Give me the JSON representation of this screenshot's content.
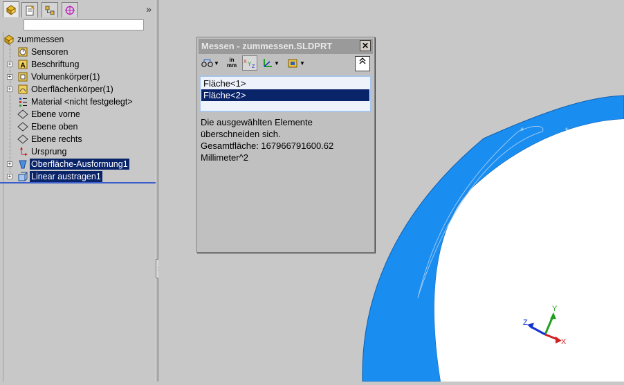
{
  "tree": {
    "root": "zummessen",
    "items": [
      {
        "label": "Sensoren",
        "icon": "sensor-icon",
        "expandable": false
      },
      {
        "label": "Beschriftung",
        "icon": "annotation-icon",
        "expandable": true
      },
      {
        "label": "Volumenkörper(1)",
        "icon": "solid-bodies-icon",
        "expandable": true
      },
      {
        "label": "Oberflächenkörper(1)",
        "icon": "surface-bodies-icon",
        "expandable": true
      },
      {
        "label": "Material <nicht festgelegt>",
        "icon": "material-icon",
        "expandable": false
      },
      {
        "label": "Ebene vorne",
        "icon": "plane-icon",
        "expandable": false
      },
      {
        "label": "Ebene oben",
        "icon": "plane-icon",
        "expandable": false
      },
      {
        "label": "Ebene rechts",
        "icon": "plane-icon",
        "expandable": false
      },
      {
        "label": "Ursprung",
        "icon": "origin-icon",
        "expandable": false
      },
      {
        "label": "Oberfläche-Ausformung1",
        "icon": "surface-loft-icon",
        "expandable": true,
        "selected": true
      },
      {
        "label": "Linear austragen1",
        "icon": "extrude-icon",
        "expandable": true,
        "selected": true
      }
    ]
  },
  "toolbar_icons": [
    "feature-manager-icon",
    "property-manager-icon",
    "configuration-manager-icon",
    "dimxpert-icon"
  ],
  "measure": {
    "title": "Messen - zummessen.SLDPRT",
    "close_label": "✕",
    "toolbar": [
      "arc-circle-measure-icon",
      "units-precision-icon",
      "xyz-icon",
      "projection-icon",
      "history-icon"
    ],
    "units_label_top": "in",
    "units_label_bottom": "mm",
    "selections": [
      "Fläche<1>",
      "Fläche<2>"
    ],
    "result_lines": [
      "Die ausgewählten Elemente",
      "überschneiden sich.",
      "Gesamtfläche: 167966791600.62",
      "Millimeter^2"
    ]
  },
  "triad": {
    "x": "X",
    "y": "Y",
    "z": "Z"
  },
  "colors": {
    "surface": "#1a8df0",
    "selection": "#0a246a",
    "background": "#c8c8c8"
  }
}
